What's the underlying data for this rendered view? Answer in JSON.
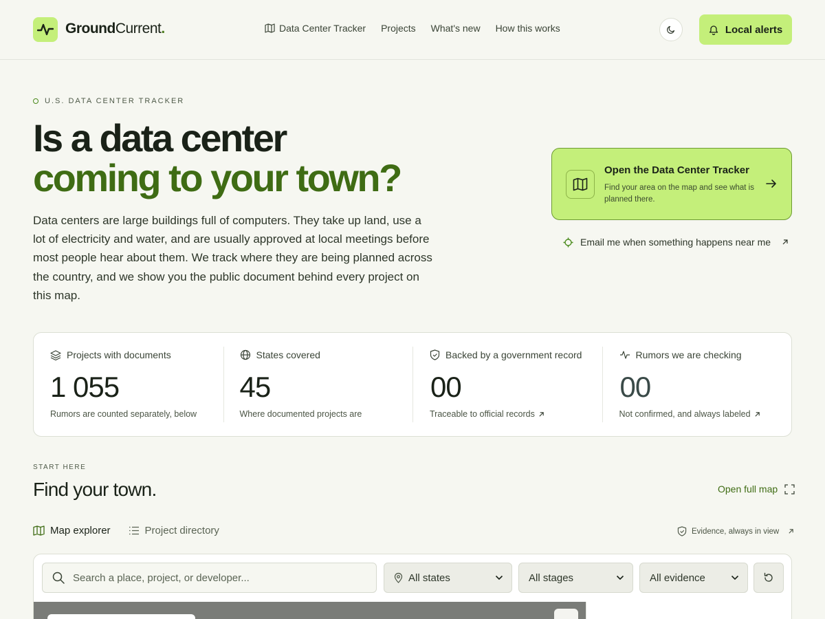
{
  "header": {
    "logo_bold": "Ground",
    "logo_light": "Current",
    "logo_dot": ".",
    "nav": [
      {
        "label": "Data Center Tracker",
        "icon": "map-icon"
      },
      {
        "label": "Projects"
      },
      {
        "label": "What's new"
      },
      {
        "label": "How this works"
      }
    ],
    "theme_icon": "moon-icon",
    "alerts_label": "Local alerts",
    "alerts_icon": "bell-icon"
  },
  "hero": {
    "eyebrow": "U.S. DATA CENTER TRACKER",
    "title_line1": "Is a data center",
    "title_line2": "coming to your town?",
    "intro": "Data centers are large buildings full of computers. They take up land, use a lot of electricity and water, and are usually approved at local meetings before most people hear about them. We track where they are being planned across the country, and we show you the public document behind every project on this map.",
    "tracker_card": {
      "title": "Open the Data Center Tracker",
      "subtitle": "Find your area on the map and see what is planned there."
    },
    "email_link": "Email me when something happens near me"
  },
  "stats": [
    {
      "label": "Projects with documents",
      "icon": "layers-icon",
      "value": "1 055",
      "sub": "Rumors are counted separately, below"
    },
    {
      "label": "States covered",
      "icon": "globe-icon",
      "value": "45",
      "sub": "Where documented projects are"
    },
    {
      "label": "Backed by a government record",
      "icon": "shield-check-icon",
      "value": "00",
      "sub": "Traceable to official records"
    },
    {
      "label": "Rumors we are checking",
      "icon": "pulse-icon",
      "value": "00",
      "sub": "Not confirmed, and always labeled"
    }
  ],
  "start": {
    "eyebrow": "START HERE",
    "title": "Find your town.",
    "open_full_map": "Open full map",
    "tabs": [
      {
        "label": "Map explorer",
        "active": true
      },
      {
        "label": "Project directory",
        "active": false
      }
    ],
    "evidence_link": "Evidence, always in view"
  },
  "filters": {
    "search_placeholder": "Search a place, project, or developer...",
    "state": "All states",
    "stage": "All stages",
    "evidence": "All evidence"
  },
  "colors": {
    "accent": "#c4ef7a",
    "accent_dark": "#3f6c14",
    "background": "#f6f7f1"
  }
}
